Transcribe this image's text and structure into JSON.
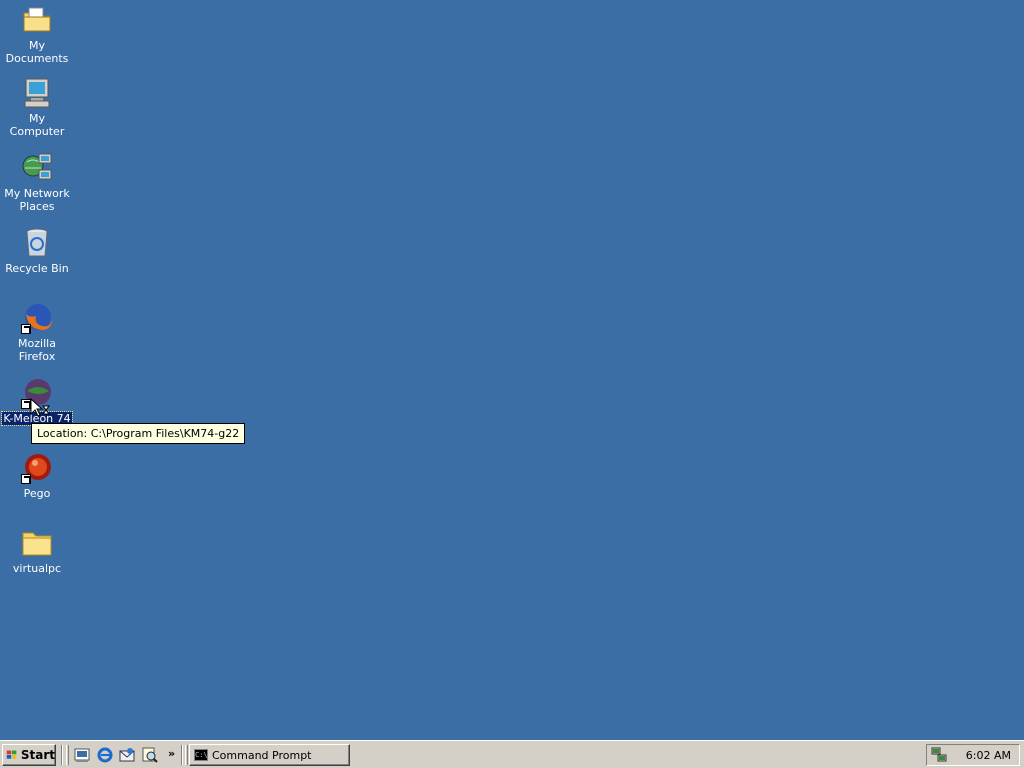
{
  "desktop": {
    "background": "#3a6ea5",
    "icons": [
      {
        "label": "My Documents",
        "icon": "my-documents-folder-icon"
      },
      {
        "label": "My Computer",
        "icon": "computer-icon"
      },
      {
        "label": "My Network Places",
        "icon": "network-places-icon"
      },
      {
        "label": "Recycle Bin",
        "icon": "recycle-bin-icon"
      },
      {
        "label": "Mozilla Firefox",
        "icon": "firefox-icon"
      },
      {
        "label": "K-Meleon 74",
        "icon": "k-meleon-icon"
      },
      {
        "label": "Pego",
        "icon": "pego-icon"
      },
      {
        "label": "virtualpc",
        "icon": "folder-icon"
      }
    ],
    "tooltip": "Location: C:\\Program Files\\KM74-g22"
  },
  "taskbar": {
    "start_label": "Start",
    "quick_launch": [
      "show-desktop-icon",
      "internet-explorer-icon",
      "outlook-express-icon",
      "search-icon"
    ],
    "chevron": "»",
    "tasks": [
      {
        "label": "Command Prompt",
        "icon": "command-prompt-icon"
      }
    ],
    "tray": {
      "clock": "6:02 AM",
      "icons": [
        "network-icon"
      ]
    }
  }
}
